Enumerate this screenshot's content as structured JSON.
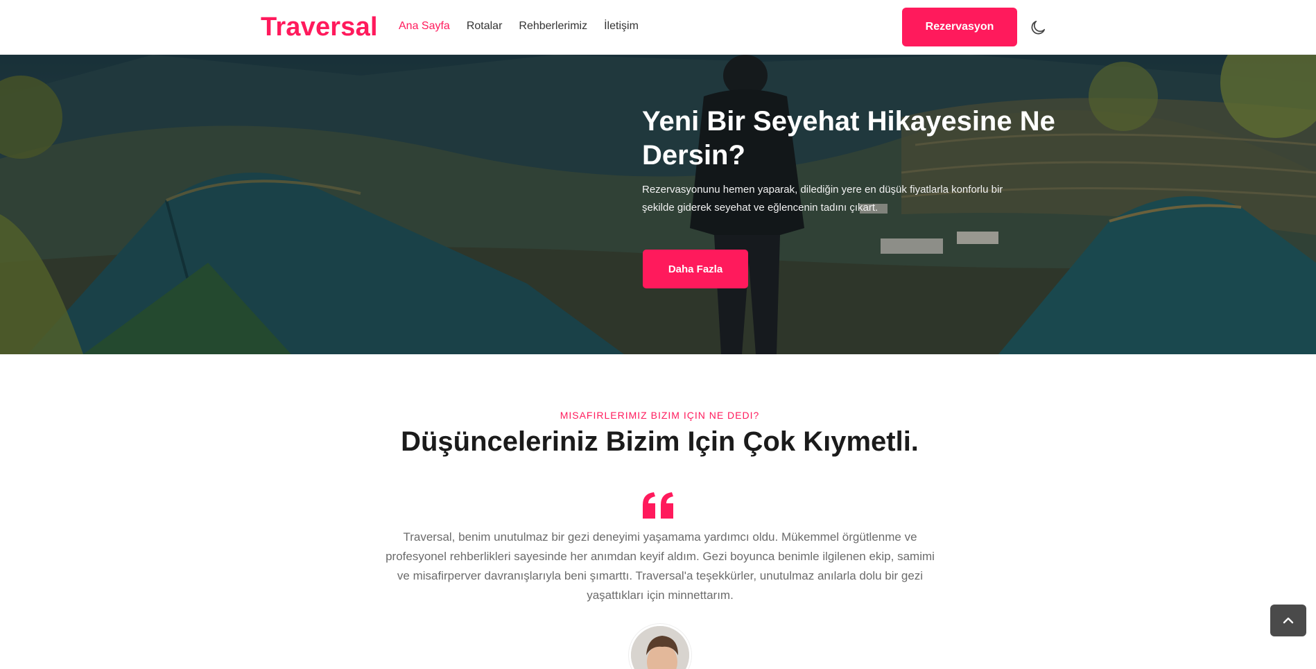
{
  "brand": "Traversal",
  "nav": {
    "items": [
      {
        "label": "Ana Sayfa",
        "active": true
      },
      {
        "label": "Rotalar",
        "active": false
      },
      {
        "label": "Rehberlerimiz",
        "active": false
      },
      {
        "label": "İletişim",
        "active": false
      }
    ],
    "reserve_label": "Rezervasyon",
    "theme_icon": "moon-icon"
  },
  "hero": {
    "title": "Yeni Bir Seyehat Hikayesine Ne Dersin?",
    "text": "Rezervasyonunu hemen yaparak, dilediğin yere en düşük fiyatlarla konforlu bir şekilde giderek seyehat ve eğlencenin tadını çıkart.",
    "button_label": "Daha Fazla"
  },
  "testimonials": {
    "eyebrow": "MISAFIRLERIMIZ BIZIM IÇIN NE DEDI?",
    "title": "Düşünceleriniz Bizim Için Çok Kıymetli.",
    "quote": "Traversal, benim unutulmaz bir gezi deneyimi yaşamama yardımcı oldu. Mükemmel örgütlenme ve profesyonel rehberlikleri sayesinde her anımdan keyif aldım. Gezi boyunca benimle ilgilenen ekip, samimi ve misafirperver davranışlarıyla beni şımarttı. Traversal'a teşekkürler, unutulmaz anılarla dolu bir gezi yaşattıkları için minnettarım."
  },
  "colors": {
    "accent": "#ff1a5c",
    "text_dark": "#1b1b1b",
    "text_muted": "#6b6b6b",
    "scroll_button": "#4a4a4a"
  },
  "icons": {
    "quote": "quote-icon",
    "scroll_top": "chevron-up-icon"
  }
}
